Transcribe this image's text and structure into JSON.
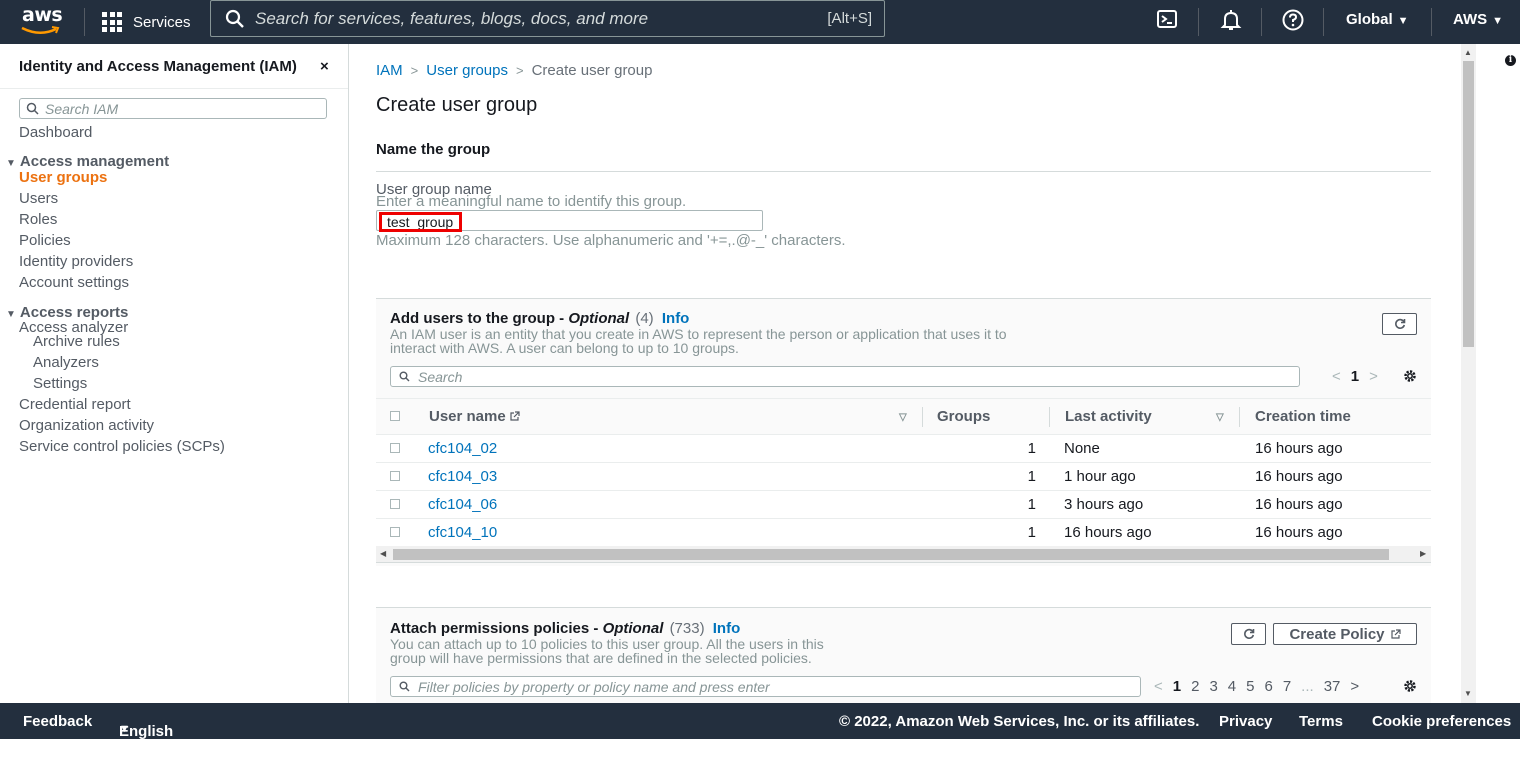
{
  "topbar": {
    "logo_text": "aws",
    "services_label": "Services",
    "search_placeholder": "Search for services, features, blogs, docs, and more",
    "search_shortcut": "[Alt+S]",
    "region_label": "Global",
    "account_label": "AWS",
    "icons": [
      "grid-icon",
      "search-icon",
      "cloudshell-icon",
      "bell-icon",
      "help-icon"
    ]
  },
  "sidebar": {
    "title": "Identity and Access Management (IAM)",
    "close": "×",
    "search_placeholder": "Search IAM",
    "dashboard": "Dashboard",
    "access_management": {
      "heading": "Access management",
      "items": [
        "User groups",
        "Users",
        "Roles",
        "Policies",
        "Identity providers",
        "Account settings"
      ],
      "active": "User groups"
    },
    "access_reports": {
      "heading": "Access reports",
      "analyzer": "Access analyzer",
      "sub_items": [
        "Archive rules",
        "Analyzers",
        "Settings"
      ],
      "items": [
        "Credential report",
        "Organization activity",
        "Service control policies (SCPs)"
      ]
    }
  },
  "breadcrumb": {
    "iam": "IAM",
    "user_groups": "User groups",
    "current": "Create user group"
  },
  "page_title": "Create user group",
  "name_section": {
    "heading": "Name the group",
    "label": "User group name",
    "description": "Enter a meaningful name to identify this group.",
    "value": "test_group",
    "hint": "Maximum 128 characters. Use alphanumeric and '+=,.@-_' characters."
  },
  "users_panel": {
    "title": "Add users to the group -",
    "optional": "Optional",
    "count": "(4)",
    "info": "Info",
    "description_line1": "An IAM user is an entity that you create in AWS to represent the person or application that uses it to",
    "description_line2": "interact with AWS. A user can belong to up to 10 groups.",
    "search_placeholder": "Search",
    "page": "1",
    "columns": [
      "User name",
      "Groups",
      "Last activity",
      "Creation time"
    ],
    "rows": [
      {
        "name": "cfc104_02",
        "groups": "1",
        "last_activity": "None",
        "created": "16 hours ago"
      },
      {
        "name": "cfc104_03",
        "groups": "1",
        "last_activity": "1 hour ago",
        "created": "16 hours ago"
      },
      {
        "name": "cfc104_06",
        "groups": "1",
        "last_activity": "3 hours ago",
        "created": "16 hours ago"
      },
      {
        "name": "cfc104_10",
        "groups": "1",
        "last_activity": "16 hours ago",
        "created": "16 hours ago"
      }
    ]
  },
  "policies_panel": {
    "title": "Attach permissions policies -",
    "optional": "Optional",
    "count": "(733)",
    "info": "Info",
    "description_line1": "You can attach up to 10 policies to this user group. All the users in this",
    "description_line2": "group will have permissions that are defined in the selected policies.",
    "create_policy": "Create Policy",
    "search_placeholder": "Filter policies by property or policy name and press enter",
    "pages": [
      "1",
      "2",
      "3",
      "4",
      "5",
      "6",
      "7",
      "...",
      "37"
    ]
  },
  "footer": {
    "feedback": "Feedback",
    "language": "English (US)",
    "copyright": "© 2022, Amazon Web Services, Inc. or its affiliates.",
    "privacy": "Privacy",
    "terms": "Terms",
    "cookies": "Cookie preferences"
  },
  "colors": {
    "nav_bg": "#232f3e",
    "link": "#0073bb",
    "active": "#ec7211",
    "highlight": "#e00000"
  }
}
